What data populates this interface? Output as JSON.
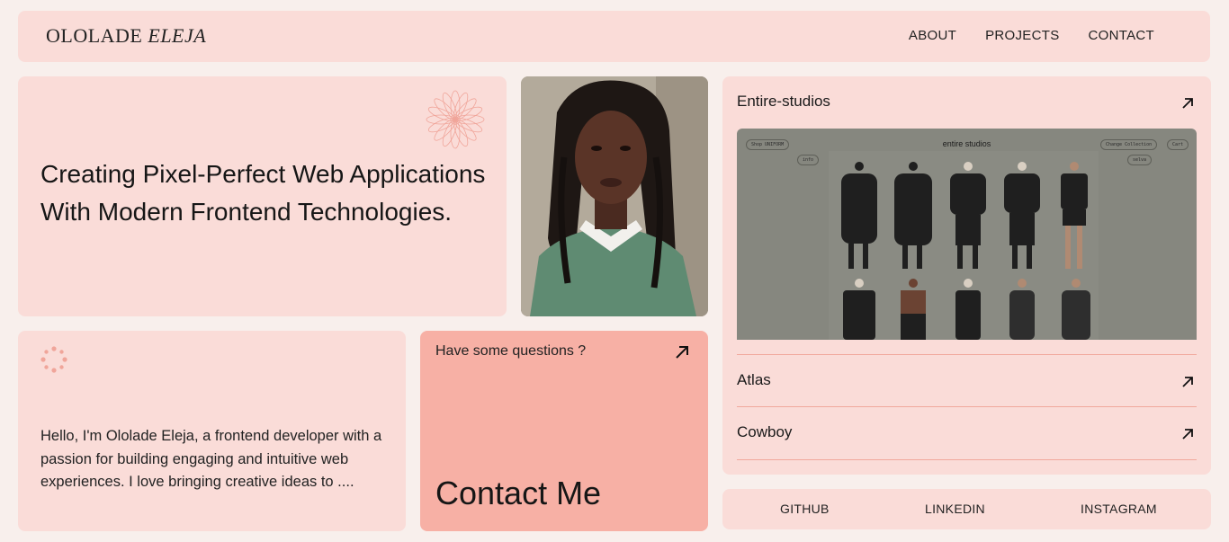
{
  "header": {
    "logo_first": "OLOLADE",
    "logo_last": "ELEJA",
    "nav": [
      {
        "label": "ABOUT"
      },
      {
        "label": "PROJECTS"
      },
      {
        "label": "CONTACT"
      }
    ]
  },
  "hero": {
    "title": "Creating Pixel-Perfect Web Applications With Modern Frontend Technologies.",
    "icon": "flower-outline-icon"
  },
  "portrait": {
    "icon": "portrait-photo"
  },
  "about": {
    "icon": "sparkle-icon",
    "text": "Hello, I'm Ololade Eleja, a frontend developer with a passion for building engaging and intuitive web experiences. I love bringing creative ideas to ...."
  },
  "contact": {
    "question": "Have some questions ?",
    "cta": "Contact Me",
    "icon": "arrow-up-right-icon"
  },
  "projects": {
    "items": [
      {
        "label": "Entire-studios"
      },
      {
        "label": "Atlas"
      },
      {
        "label": "Cowboy"
      }
    ],
    "preview": {
      "brand": "entire studios",
      "shop_pill": "Shop UNIFORM",
      "info_pill": "info",
      "change_pill": "Change Collection",
      "cart_pill": "Cart",
      "select_pill": "selva"
    }
  },
  "socials": [
    {
      "label": "GITHUB"
    },
    {
      "label": "LINKEDIN"
    },
    {
      "label": "INSTAGRAM"
    }
  ],
  "colors": {
    "background": "#f8efec",
    "card": "#fadcd8",
    "contact_card": "#f7b0a5",
    "accent_line": "#f1a89c"
  }
}
